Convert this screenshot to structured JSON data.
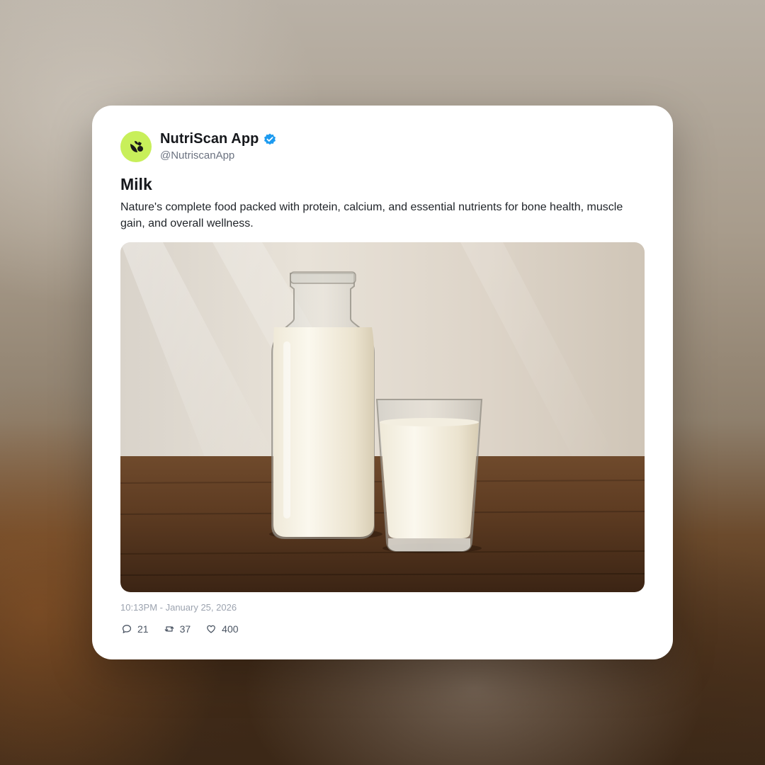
{
  "post": {
    "author": {
      "display_name": "NutriScan App",
      "handle": "@NutriscanApp",
      "verified": true,
      "avatar_color": "#c8ef5a"
    },
    "title": "Milk",
    "body": "Nature's complete food packed with protein, calcium, and essential nutrients for bone health, muscle gain, and overall wellness.",
    "image_icon": "milk-bottle-and-glass-photo",
    "timestamp": "10:13PM - January 25, 2026",
    "stats": {
      "replies": "21",
      "reposts": "37",
      "likes": "400"
    }
  },
  "icons": {
    "reply": "speech-bubble-icon",
    "repost": "repost-arrows-icon",
    "like": "heart-icon",
    "verified": "verified-badge-icon"
  },
  "colors": {
    "verified": "#1d9bf0",
    "muted_text": "#9ca3af",
    "card_bg": "#ffffff"
  }
}
